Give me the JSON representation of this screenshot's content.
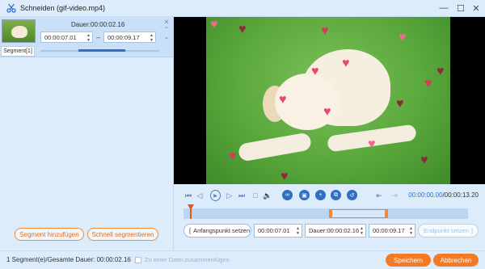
{
  "window": {
    "title": "Schneiden (gif-video.mp4)",
    "minimize_glyph": "—",
    "maximize_glyph": "☐",
    "close_glyph": "✕"
  },
  "segment": {
    "label": "Segment[1]",
    "duration": "Dauer:00:00:02.16",
    "start": "00:00:07.01",
    "end": "00:00:09.17",
    "separator": "–",
    "progress_fraction": 0.4
  },
  "left_buttons": {
    "add_segment": "Segment hinzufügen",
    "quick_segment": "Schnell segmentieren"
  },
  "player": {
    "current_time": "00:00:00.00",
    "total_time": "/00:00:13.20"
  },
  "fields": {
    "set_start": "Anfangspunkt setzen",
    "start_value": "00:00:07.01",
    "duration_value": "Dauer:00:00:02.16",
    "end_value": "00:00:09.17",
    "set_end": "Endpunkt setzen"
  },
  "status": {
    "summary": "1 Segment(e)/Gesamte Dauer: 00:00:02.16",
    "merge_label": "Zu einer Datei zusammenfügen"
  },
  "footer_buttons": {
    "save": "Speichern",
    "cancel": "Abbrechen"
  },
  "colors": {
    "accent_orange": "#f47a26",
    "accent_blue": "#2f6fc5",
    "background": "#dcecfb"
  }
}
